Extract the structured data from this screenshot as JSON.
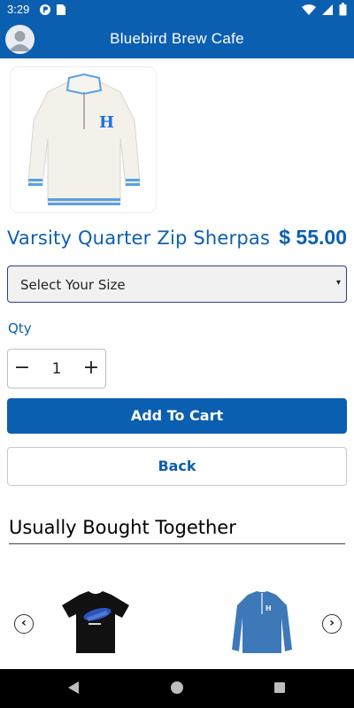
{
  "status_bar": {
    "time": "3:29",
    "left_icons": [
      "p-circle-icon",
      "card-icon"
    ],
    "right_icons": [
      "wifi-icon",
      "cellular-icon",
      "battery-icon"
    ]
  },
  "app_bar": {
    "title": "Bluebird Brew Cafe",
    "avatar_icon": "user-avatar-icon"
  },
  "product": {
    "name": "Varsity Quarter Zip Sherpas",
    "price": "$ 55.00",
    "image_icon": "sherpa-quarter-zip-image"
  },
  "size_select": {
    "value": "Select Your Size",
    "caret": "▾"
  },
  "quantity": {
    "label": "Qty",
    "value": "1",
    "minus": "−",
    "plus": "+"
  },
  "buttons": {
    "add_to_cart": "Add To Cart",
    "back": "Back"
  },
  "related": {
    "title": "Usually Bought Together",
    "prev_arrow": "‹",
    "next_arrow": "›",
    "items": [
      {
        "icon": "black-tshirt-image"
      },
      {
        "icon": "blue-quarter-zip-image"
      }
    ]
  },
  "colors": {
    "brand_blue": "#0b5fb0",
    "nav_bar": "#000000"
  }
}
